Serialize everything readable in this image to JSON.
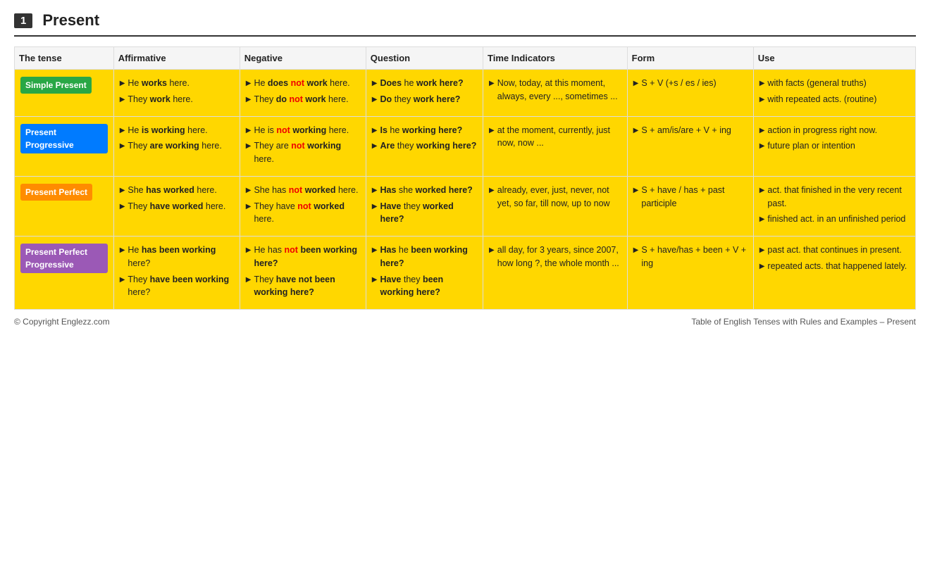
{
  "header": {
    "number": "1",
    "title": "Present"
  },
  "columns": [
    "The tense",
    "Affirmative",
    "Negative",
    "Question",
    "Time Indicators",
    "Form",
    "Use"
  ],
  "rows": [
    {
      "id": "simple-present",
      "tense_label": "Simple Present",
      "tense_class": "simple",
      "affirmative": [
        "He <b>works</b> here.",
        "They <b>work</b> here."
      ],
      "negative": [
        "He <b>does</b> <not>not</not> <b>work</b> here.",
        "They <b>do</b> <not>not</not> <b>work</b> here."
      ],
      "question": [
        "<b>Does</b> he <b>work here?</b>",
        "<b>Do</b> they <b>work here?</b>"
      ],
      "time": "Now, today, at this moment, always, every ..., sometimes ...",
      "form": "S + V (+s / es / ies)",
      "use": [
        "with facts (general truths)",
        "with repeated acts. (routine)"
      ]
    },
    {
      "id": "present-progressive",
      "tense_label": "Present Progressive",
      "tense_class": "progressive",
      "affirmative": [
        "He <b>is working</b> here.",
        "They <b>are working</b> here."
      ],
      "negative": [
        "He is <not>not</not> <b>working</b> here.",
        "They are <not>not</not> <b>working</b> here."
      ],
      "question": [
        "<b>Is</b> he <b>working here?</b>",
        "<b>Are</b> they <b>working here?</b>"
      ],
      "time": "at the moment, currently, just now, now ...",
      "form": "S + am/is/are + V + ing",
      "use": [
        "action in progress right now.",
        "future plan or intention"
      ]
    },
    {
      "id": "present-perfect",
      "tense_label": "Present Perfect",
      "tense_class": "perfect",
      "affirmative": [
        "She <b>has worked</b> here.",
        "They <b>have worked</b> here."
      ],
      "negative": [
        "She has <not>not</not> <b>worked</b> here.",
        "They have <not>not</not> <b>worked</b> here."
      ],
      "question": [
        "<b>Has</b> she <b>worked here?</b>",
        "<b>Have</b> they <b>worked here?</b>"
      ],
      "time": "already, ever, just, never, not yet, so far, till now, up to now",
      "form": "S + have / has + past participle",
      "use": [
        "act. that finished in the very recent past.",
        "finished act. in an unfinished period"
      ]
    },
    {
      "id": "present-perfect-progressive",
      "tense_label": "Present Perfect Progressive",
      "tense_class": "perf-prog",
      "affirmative": [
        "He <b>has been working</b> here?",
        "They <b>have been working</b> here?"
      ],
      "negative": [
        "He has <not>not</not> <b>been working here?</b>",
        "They <b>have not been working here?</b>"
      ],
      "question": [
        "<b>Has</b> he <b>been working here?</b>",
        "<b>Have</b> they <b>been working here?</b>"
      ],
      "time": "all day, for 3 years, since 2007, how long ?, the whole month ...",
      "form": "S + have/has + been + V + ing",
      "use": [
        "past act. that continues in present.",
        "repeated acts. that happened lately."
      ]
    }
  ],
  "footer": {
    "copyright": "© Copyright Englezz.com",
    "caption": "Table of English Tenses with Rules and Examples – Present"
  }
}
